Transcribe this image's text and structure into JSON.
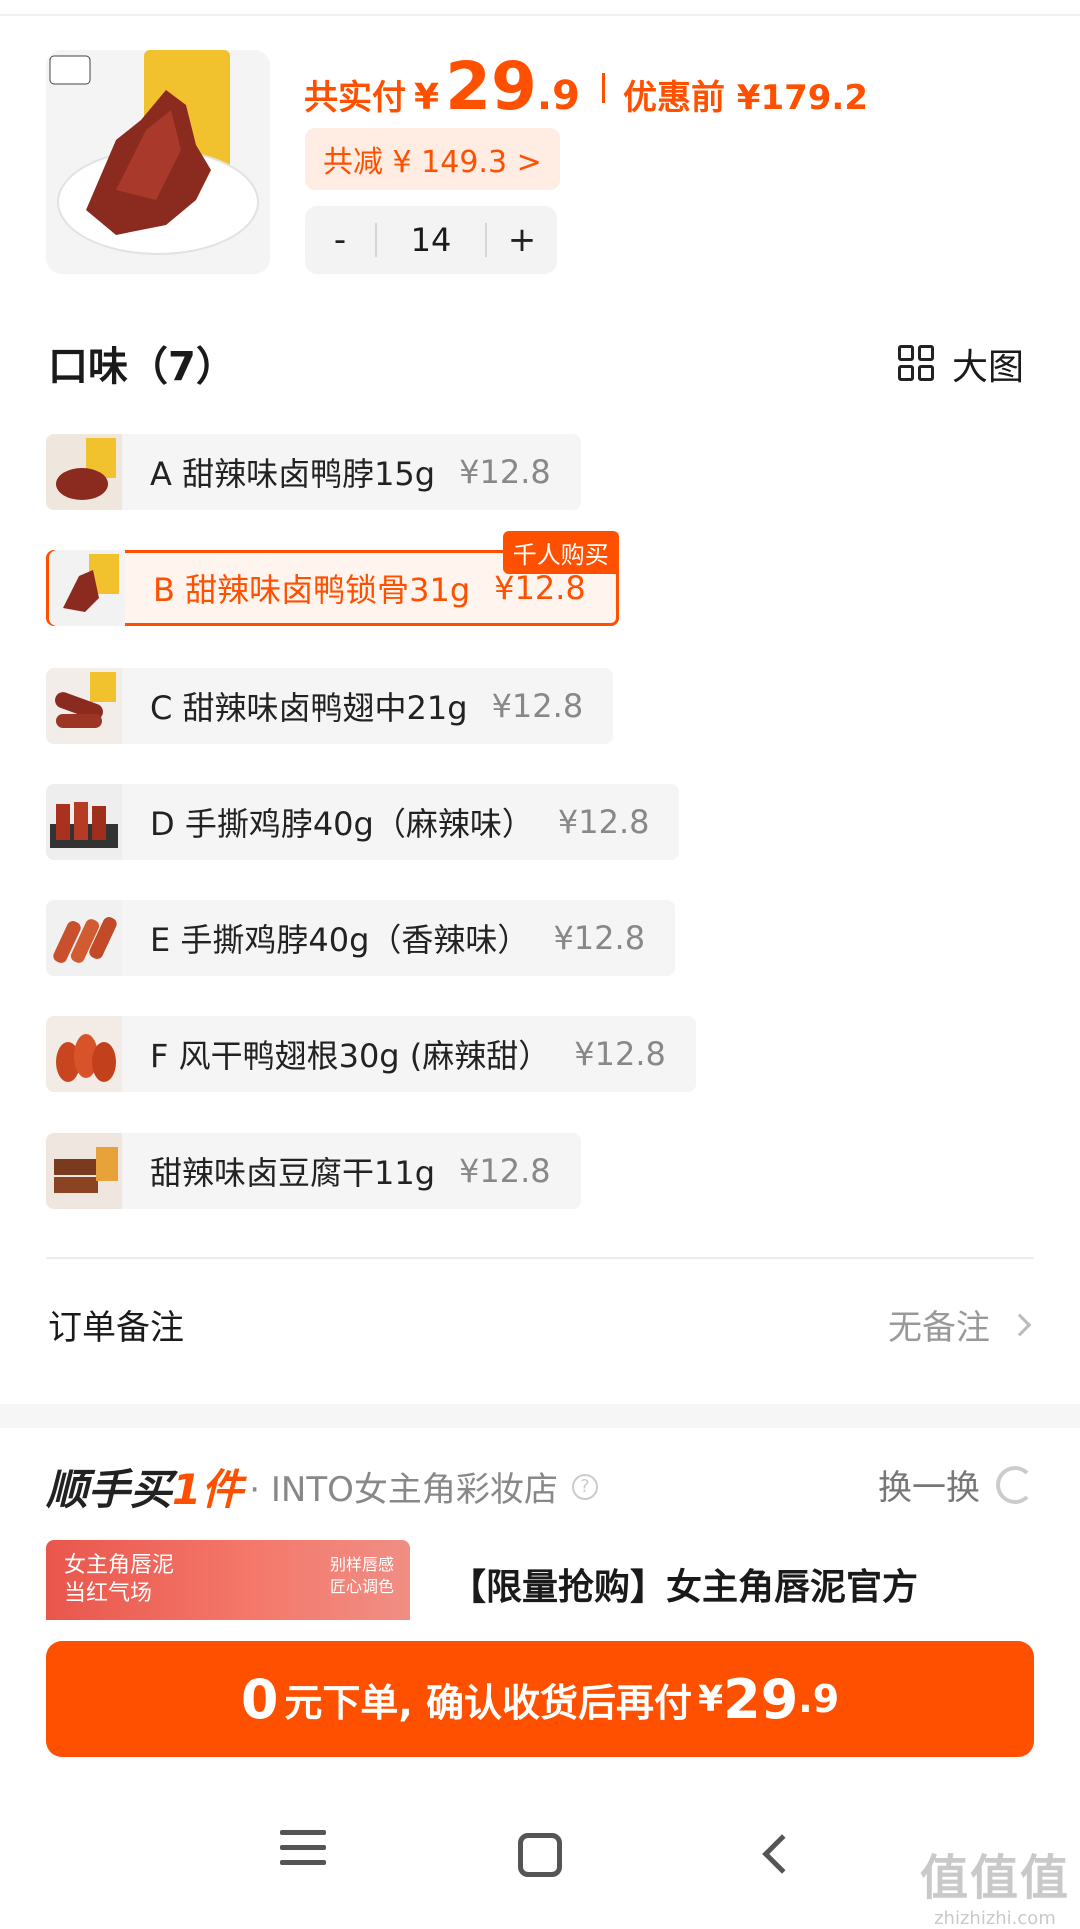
{
  "product": {
    "thumb_alt": "product-image",
    "total_label": "共实付",
    "currency": "¥",
    "price_int": "29",
    "price_dec": ".9",
    "original": "优惠前 ¥179.2",
    "discount": "共减 ¥ 149.3 >",
    "quantity": "14",
    "minus": "-",
    "plus": "+"
  },
  "flavors": {
    "title": "口味（7）",
    "big_view": "大图",
    "items": [
      {
        "name": "A 甜辣味卤鸭脖15g",
        "price": "¥12.8"
      },
      {
        "name": "B 甜辣味卤鸭锁骨31g",
        "price": "¥12.8",
        "badge": "千人购买"
      },
      {
        "name": "C 甜辣味卤鸭翅中21g",
        "price": "¥12.8"
      },
      {
        "name": "D 手撕鸡脖40g（麻辣味）",
        "price": "¥12.8"
      },
      {
        "name": "E 手撕鸡脖40g（香辣味）",
        "price": "¥12.8"
      },
      {
        "name": "F 风干鸭翅根30g (麻辣甜）",
        "price": "¥12.8"
      },
      {
        "name": "甜辣味卤豆腐干11g",
        "price": "¥12.8"
      }
    ]
  },
  "remark": {
    "label": "订单备注",
    "value": "无备注"
  },
  "shunshou": {
    "logo_a": "顺手买",
    "logo_b": "1件",
    "store": "· INTO女主角彩妆店",
    "help": "?",
    "swap": "换一换",
    "promo_img_line1": "女主角唇泥",
    "promo_img_line2": "当红气场",
    "promo_img_right1": "别样唇感",
    "promo_img_right2": "匠心调色",
    "promo_title": "【限量抢购】女主角唇泥官方"
  },
  "order_button": {
    "zero": "0",
    "text": "元下单, 确认收货后再付",
    "yen": "¥",
    "int": "29",
    "dec": ".9"
  },
  "watermark": {
    "line1": "值值值",
    "line2": "zhizhizhi.com"
  },
  "colors": {
    "accent": "#ff5000",
    "accent_light": "#ffece3"
  }
}
